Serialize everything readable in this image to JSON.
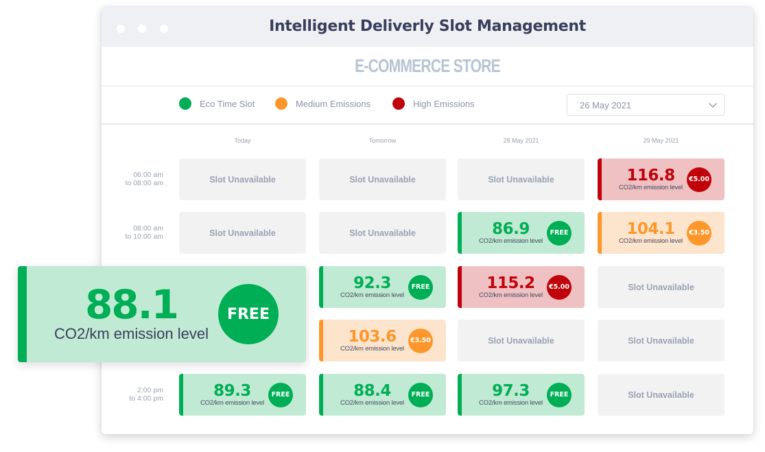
{
  "window": {
    "title": "Intelligent Deliverly Slot Management",
    "store_name": "E-COMMERCE STORE"
  },
  "legend": [
    {
      "label": "Eco Time Slot",
      "color": "#00ae55"
    },
    {
      "label": "Medium Emissions",
      "color": "#fd972b"
    },
    {
      "label": "High Emissions",
      "color": "#c0020a"
    }
  ],
  "date_select": {
    "value": "26 May 2021",
    "icon": "chevron-down-icon"
  },
  "columns": [
    "Today",
    "Tomorrow",
    "28 May 2021",
    "29 May 2021"
  ],
  "unit_label": "CO2/km emission level",
  "unavailable_label": "Slot Unavailable",
  "rows": [
    {
      "time": [
        "06:00 am",
        "to 08:00 am"
      ],
      "slots": [
        {
          "status": "unavailable"
        },
        {
          "status": "unavailable"
        },
        {
          "status": "unavailable"
        },
        {
          "status": "high",
          "value": "116.8",
          "price": "€5.00"
        }
      ]
    },
    {
      "time": [
        "08:00 am",
        "to 10:00 am"
      ],
      "slots": [
        {
          "status": "unavailable"
        },
        {
          "status": "unavailable"
        },
        {
          "status": "eco",
          "value": "86.9",
          "price": "FREE"
        },
        {
          "status": "medium",
          "value": "104.1",
          "price": "€3.50"
        }
      ]
    },
    {
      "time": [
        "",
        ""
      ],
      "slots": [
        {
          "status": "hidden"
        },
        {
          "status": "eco",
          "value": "92.3",
          "price": "FREE"
        },
        {
          "status": "high",
          "value": "115.2",
          "price": "€5.00"
        },
        {
          "status": "unavailable"
        }
      ]
    },
    {
      "time": [
        "",
        ""
      ],
      "slots": [
        {
          "status": "hidden"
        },
        {
          "status": "medium",
          "value": "103.6",
          "price": "€3.50"
        },
        {
          "status": "unavailable"
        },
        {
          "status": "unavailable"
        }
      ]
    },
    {
      "time": [
        "2:00 pm",
        "to 4:00 pm"
      ],
      "slots": [
        {
          "status": "eco",
          "value": "89.3",
          "price": "FREE"
        },
        {
          "status": "eco",
          "value": "88.4",
          "price": "FREE"
        },
        {
          "status": "eco",
          "value": "97.3",
          "price": "FREE"
        },
        {
          "status": "unavailable"
        }
      ]
    }
  ],
  "popup": {
    "status": "eco",
    "value": "88.1",
    "label": "CO2/km emission level",
    "price": "FREE"
  }
}
